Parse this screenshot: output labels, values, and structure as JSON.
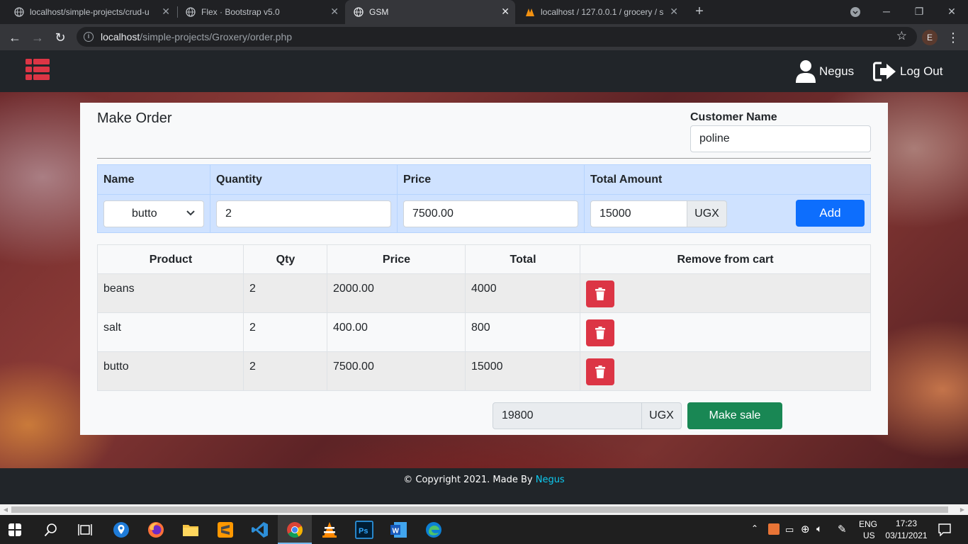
{
  "browser": {
    "tabs": [
      {
        "title": "localhost/simple-projects/crud-u",
        "active": false
      },
      {
        "title": "Flex · Bootstrap v5.0",
        "active": false
      },
      {
        "title": "GSM",
        "active": true
      },
      {
        "title": "localhost / 127.0.0.1 / grocery / s",
        "active": false
      }
    ],
    "url_host": "localhost",
    "url_path": "/simple-projects/Groxery/order.php",
    "profile_initial": "E"
  },
  "navbar": {
    "user_label": "Negus",
    "logout_label": "Log Out"
  },
  "order": {
    "title": "Make Order",
    "customer_label": "Customer Name",
    "customer_value": "poline",
    "form_headers": [
      "Name",
      "Quantity",
      "Price",
      "Total Amount"
    ],
    "selected_product": "butto",
    "quantity": "2",
    "price": "7500.00",
    "total_amount": "15000",
    "currency": "UGX",
    "add_label": "Add"
  },
  "cart": {
    "headers": [
      "Product",
      "Qty",
      "Price",
      "Total",
      "Remove from cart"
    ],
    "rows": [
      {
        "product": "beans",
        "qty": "2",
        "price": "2000.00",
        "total": "4000"
      },
      {
        "product": "salt",
        "qty": "2",
        "price": "400.00",
        "total": "800"
      },
      {
        "product": "butto",
        "qty": "2",
        "price": "7500.00",
        "total": "15000"
      }
    ],
    "grand_total": "19800",
    "currency": "UGX",
    "make_sale_label": "Make sale"
  },
  "footer": {
    "text": "© Copyright 2021. Made By",
    "author": "Negus"
  },
  "taskbar": {
    "lang_line1": "ENG",
    "lang_line2": "US",
    "time": "17:23",
    "date": "03/11/2021"
  },
  "colors": {
    "brand_red": "#dc3545",
    "primary": "#0d6efd",
    "success": "#198754",
    "navbar": "#212529"
  }
}
